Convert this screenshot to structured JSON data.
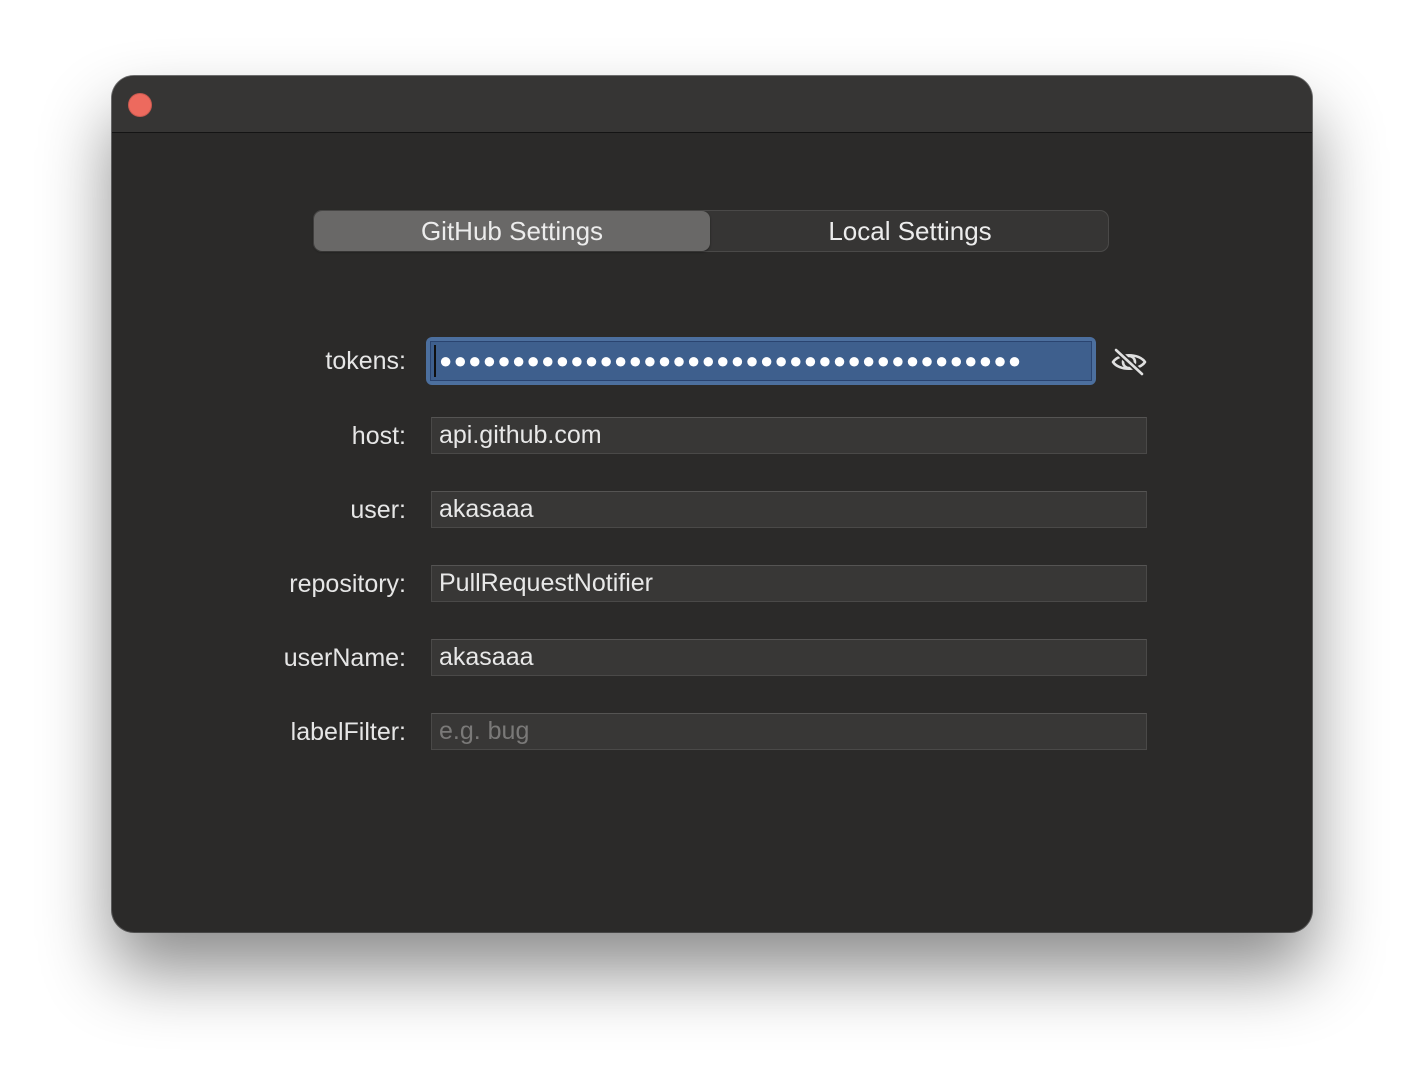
{
  "tabs": [
    {
      "label": "GitHub Settings",
      "active": true
    },
    {
      "label": "Local Settings",
      "active": false
    }
  ],
  "form": {
    "tokens": {
      "label": "tokens:",
      "masked_value": "●●●●●●●●●●●●●●●●●●●●●●●●●●●●●●●●●●●●●●●●"
    },
    "host": {
      "label": "host:",
      "value": "api.github.com"
    },
    "user": {
      "label": "user:",
      "value": "akasaaa"
    },
    "repository": {
      "label": "repository:",
      "value": "PullRequestNotifier"
    },
    "userName": {
      "label": "userName:",
      "value": "akasaaa"
    },
    "labelFilter": {
      "label": "labelFilter:",
      "value": "",
      "placeholder": "e.g. bug"
    }
  },
  "icons": {
    "close": "close-icon",
    "visibility": "eye-slash-icon"
  },
  "colors": {
    "close_button": "#ed6a5e",
    "focus_ring": "#4c6f9e",
    "window_bg": "#2b2a29",
    "active_segment": "#696867"
  }
}
